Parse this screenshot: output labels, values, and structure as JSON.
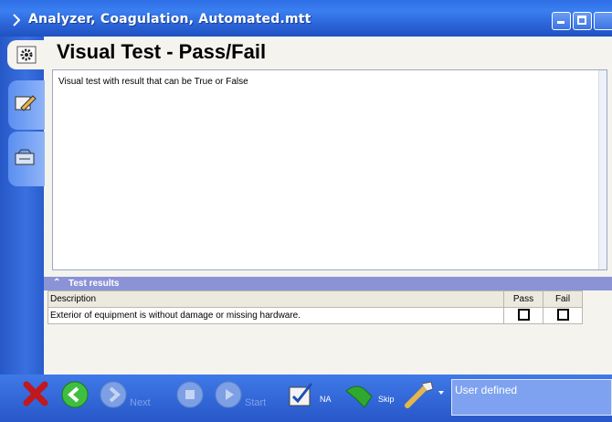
{
  "window": {
    "title": "Analyzer, Coagulation, Automated.mtt"
  },
  "step": {
    "heading": "Visual Test - Pass/Fail",
    "description": "Visual test with result that can be True or False"
  },
  "results": {
    "section_label": "Test results",
    "columns": [
      "Description",
      "Pass",
      "Fail"
    ],
    "rows": [
      {
        "description": "Exterior of equipment is without damage or missing hardware.",
        "pass": false,
        "fail": false
      }
    ]
  },
  "toolbar": {
    "buttons": [
      {
        "icon": "cancel-icon"
      },
      {
        "icon": "back-icon"
      },
      {
        "icon": "forward-icon",
        "label": "Next",
        "enabled": false
      },
      {
        "icon": "stop-icon",
        "enabled": false
      },
      {
        "icon": "play-icon",
        "label": "Start",
        "enabled": false
      },
      {
        "icon": "checklist-icon",
        "label": "NA"
      },
      {
        "icon": "skip-icon",
        "label": "Skip"
      },
      {
        "icon": "tools-icon"
      }
    ],
    "user_field_value": "User defined"
  },
  "colors": {
    "accent": "#2a62d6",
    "section_header": "#8b93d6"
  }
}
